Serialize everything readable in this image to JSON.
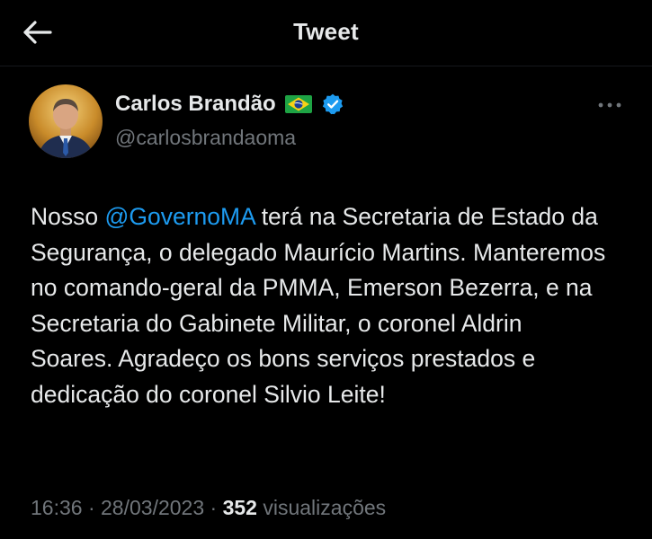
{
  "header": {
    "title": "Tweet",
    "back_icon": "arrow-left-icon"
  },
  "author": {
    "display_name": "Carlos Brandão",
    "flag_emoji": "brazil-flag-icon",
    "verified_icon": "verified-badge-icon",
    "handle": "@carlosbrandaoma",
    "avatar_icon": "avatar-photo"
  },
  "tweet": {
    "text_before": "Nosso ",
    "mention": "@GovernoMA",
    "text_after": " terá na Secretaria de Estado da Segurança, o delegado Maurício Martins. Manteremos no comando-geral da PMMA, Emerson Bezerra, e na Secretaria do Gabinete Militar, o coronel Aldrin Soares. Agradeço os bons serviços prestados e dedicação do coronel Silvio Leite!"
  },
  "meta": {
    "time": "16:36",
    "sep1": " · ",
    "date": "28/03/2023",
    "sep2": " · ",
    "views_count": "352",
    "views_label": " visualizações"
  },
  "colors": {
    "background": "#000000",
    "text": "#e7e9ea",
    "secondary": "#71767b",
    "accent": "#1d9bf0"
  }
}
